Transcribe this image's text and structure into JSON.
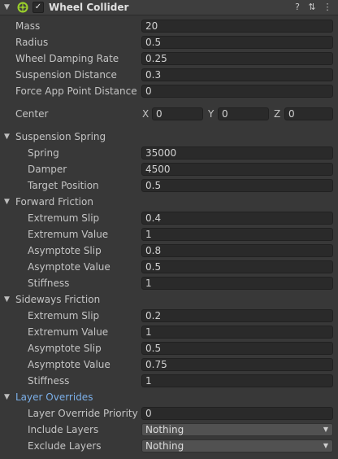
{
  "header": {
    "title": "Wheel Collider",
    "enabled_mark": "✓",
    "help_icon": "?",
    "presets_icon": "⇅",
    "menu_icon": "⋮",
    "fold_icon": "▼"
  },
  "properties": {
    "mass": {
      "label": "Mass",
      "value": "20"
    },
    "radius": {
      "label": "Radius",
      "value": "0.5"
    },
    "wheel_damping_rate": {
      "label": "Wheel Damping Rate",
      "value": "0.25"
    },
    "suspension_distance": {
      "label": "Suspension Distance",
      "value": "0.3"
    },
    "force_app_point_distance": {
      "label": "Force App Point Distance",
      "value": "0"
    }
  },
  "center": {
    "label": "Center",
    "x_label": "X",
    "x": "0",
    "y_label": "Y",
    "y": "0",
    "z_label": "Z",
    "z": "0"
  },
  "suspension_spring": {
    "title": "Suspension Spring",
    "spring": {
      "label": "Spring",
      "value": "35000"
    },
    "damper": {
      "label": "Damper",
      "value": "4500"
    },
    "target_position": {
      "label": "Target Position",
      "value": "0.5"
    }
  },
  "forward_friction": {
    "title": "Forward Friction",
    "extremum_slip": {
      "label": "Extremum Slip",
      "value": "0.4"
    },
    "extremum_value": {
      "label": "Extremum Value",
      "value": "1"
    },
    "asymptote_slip": {
      "label": "Asymptote Slip",
      "value": "0.8"
    },
    "asymptote_value": {
      "label": "Asymptote Value",
      "value": "0.5"
    },
    "stiffness": {
      "label": "Stiffness",
      "value": "1"
    }
  },
  "sideways_friction": {
    "title": "Sideways Friction",
    "extremum_slip": {
      "label": "Extremum Slip",
      "value": "0.2"
    },
    "extremum_value": {
      "label": "Extremum Value",
      "value": "1"
    },
    "asymptote_slip": {
      "label": "Asymptote Slip",
      "value": "0.5"
    },
    "asymptote_value": {
      "label": "Asymptote Value",
      "value": "0.75"
    },
    "stiffness": {
      "label": "Stiffness",
      "value": "1"
    }
  },
  "layer_overrides": {
    "title": "Layer Overrides",
    "priority": {
      "label": "Layer Override Priority",
      "value": "0"
    },
    "include_layers": {
      "label": "Include Layers",
      "value": "Nothing"
    },
    "exclude_layers": {
      "label": "Exclude Layers",
      "value": "Nothing"
    }
  },
  "colors": {
    "background": "#383838",
    "header": "#3e3e3e",
    "field": "#2a2a2a",
    "dropdown": "#515151",
    "link_blue": "#7bafe8",
    "icon_green": "#9bd12a"
  }
}
